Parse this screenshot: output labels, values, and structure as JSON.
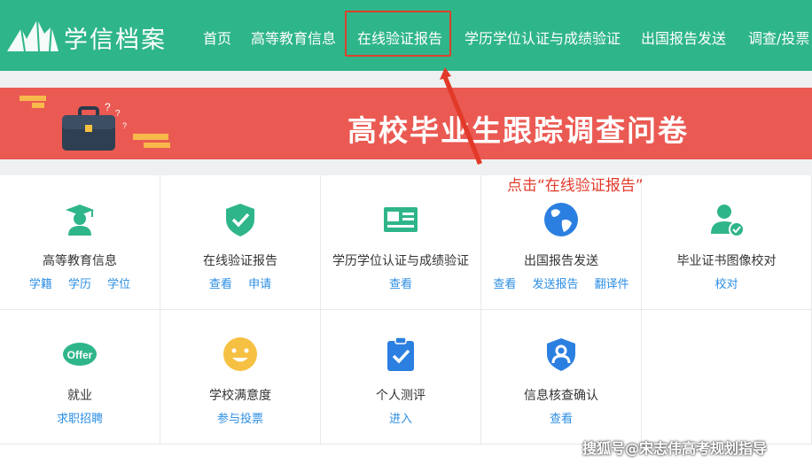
{
  "header": {
    "brand": "学信档案",
    "nav": [
      "首页",
      "高等教育信息",
      "在线验证报告",
      "学历学位认证与成绩验证",
      "出国报告发送",
      "调查/投票"
    ]
  },
  "banner": {
    "title": "高校毕业生跟踪调查问卷"
  },
  "annotation": "点击“在线验证报告”",
  "services": [
    {
      "title": "高等教育信息",
      "links": [
        "学籍",
        "学历",
        "学位"
      ],
      "icon": "graduate-icon"
    },
    {
      "title": "在线验证报告",
      "links": [
        "查看",
        "申请"
      ],
      "icon": "shield-check-icon"
    },
    {
      "title": "学历学位认证与成绩验证",
      "links": [
        "查看"
      ],
      "icon": "id-card-icon"
    },
    {
      "title": "出国报告发送",
      "links": [
        "查看",
        "发送报告",
        "翻译件"
      ],
      "icon": "globe-icon"
    },
    {
      "title": "毕业证书图像校对",
      "links": [
        "校对"
      ],
      "icon": "user-check-icon"
    },
    {
      "title": "就业",
      "links": [
        "求职招聘"
      ],
      "icon": "offer-icon"
    },
    {
      "title": "学校满意度",
      "links": [
        "参与投票"
      ],
      "icon": "smiley-icon"
    },
    {
      "title": "个人测评",
      "links": [
        "进入"
      ],
      "icon": "clipboard-check-icon"
    },
    {
      "title": "信息核查确认",
      "links": [
        "查看"
      ],
      "icon": "shield-user-icon"
    }
  ],
  "watermark": "搜狐号@宋志伟高考规划指导",
  "colors": {
    "header": "#2fb58a",
    "banner": "#ea5a53",
    "link": "#2b8ee3",
    "annotation": "#e23a2a"
  }
}
